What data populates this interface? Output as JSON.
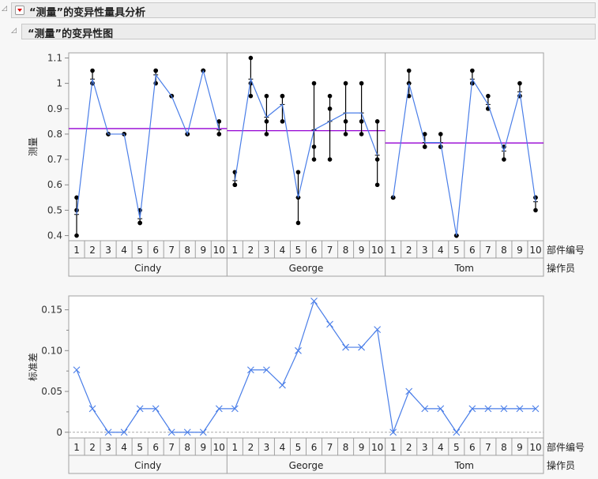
{
  "header": {
    "outline_title": "“测量”的变异性量具分析",
    "chart_title": "“测量”的变异性图"
  },
  "labels": {
    "part_axis": "部件编号",
    "operator_axis": "操作员"
  },
  "colors": {
    "mean_line": "#9400d3",
    "series_line": "#4a7ee8",
    "points": "#000000",
    "frame": "#a0a0a0",
    "tick_label": "#333333"
  },
  "chart_data": [
    {
      "type": "line",
      "title": "“测量”的变异性图",
      "ylabel": "测量",
      "ylim": [
        0.38,
        1.12
      ],
      "yticks": [
        0.4,
        0.5,
        0.6,
        0.7,
        0.8,
        0.9,
        1.0,
        1.1
      ],
      "ytick_labels": [
        "0.4",
        "0.5",
        "0.6",
        "0.7",
        "0.8",
        "0.9",
        "1",
        "1.1"
      ],
      "parts": [
        "1",
        "2",
        "3",
        "4",
        "5",
        "6",
        "7",
        "8",
        "9",
        "10"
      ],
      "operators": [
        {
          "name": "Cindy",
          "mean": 0.8217,
          "measurements": [
            [
              0.55,
              0.5,
              0.4
            ],
            [
              1.05,
              1.0,
              1.0
            ],
            [
              0.8,
              0.8,
              0.8
            ],
            [
              0.8,
              0.8,
              0.8
            ],
            [
              0.5,
              0.45,
              0.45
            ],
            [
              1.05,
              1.0,
              1.05
            ],
            [
              0.95,
              0.95,
              0.95
            ],
            [
              0.8,
              0.8,
              0.8
            ],
            [
              1.05,
              1.05,
              1.05
            ],
            [
              0.85,
              0.8,
              0.8
            ]
          ]
        },
        {
          "name": "George",
          "mean": 0.8133,
          "measurements": [
            [
              0.65,
              0.6,
              0.6
            ],
            [
              1.1,
              1.0,
              0.95
            ],
            [
              0.95,
              0.85,
              0.8
            ],
            [
              0.95,
              0.85,
              0.95
            ],
            [
              0.65,
              0.55,
              0.45
            ],
            [
              1.0,
              0.75,
              0.7
            ],
            [
              0.95,
              0.9,
              0.7
            ],
            [
              1.0,
              0.85,
              0.8
            ],
            [
              1.0,
              0.85,
              0.8
            ],
            [
              0.85,
              0.7,
              0.6
            ]
          ]
        },
        {
          "name": "Tom",
          "mean": 0.765,
          "measurements": [
            [
              0.55,
              0.55,
              0.55
            ],
            [
              1.05,
              1.0,
              0.95
            ],
            [
              0.8,
              0.75,
              0.75
            ],
            [
              0.8,
              0.75,
              0.75
            ],
            [
              0.4,
              0.4,
              0.4
            ],
            [
              1.05,
              1.0,
              1.0
            ],
            [
              0.95,
              0.9,
              0.9
            ],
            [
              0.75,
              0.7,
              0.75
            ],
            [
              1.0,
              0.95,
              0.95
            ],
            [
              0.55,
              0.5,
              0.55
            ]
          ]
        }
      ]
    },
    {
      "type": "line",
      "ylabel": "标准差",
      "ylim": [
        -0.007,
        0.167
      ],
      "yticks": [
        0,
        0.05,
        0.1,
        0.15
      ],
      "ytick_labels": [
        "0",
        "0.05",
        "0.10",
        "0.15"
      ],
      "minor_yticks": [
        0.025,
        0.075,
        0.125
      ],
      "parts": [
        "1",
        "2",
        "3",
        "4",
        "5",
        "6",
        "7",
        "8",
        "9",
        "10"
      ],
      "series": [
        {
          "name": "Cindy",
          "values": [
            0.0764,
            0.0289,
            0,
            0,
            0.0289,
            0.0289,
            0,
            0,
            0,
            0.0289
          ]
        },
        {
          "name": "George",
          "values": [
            0.0289,
            0.0764,
            0.0764,
            0.0577,
            0.1,
            0.1607,
            0.1323,
            0.1041,
            0.1041,
            0.1258
          ]
        },
        {
          "name": "Tom",
          "values": [
            0,
            0.05,
            0.0289,
            0.0289,
            0,
            0.0289,
            0.0289,
            0.0289,
            0.0289,
            0.0289
          ]
        }
      ]
    }
  ]
}
